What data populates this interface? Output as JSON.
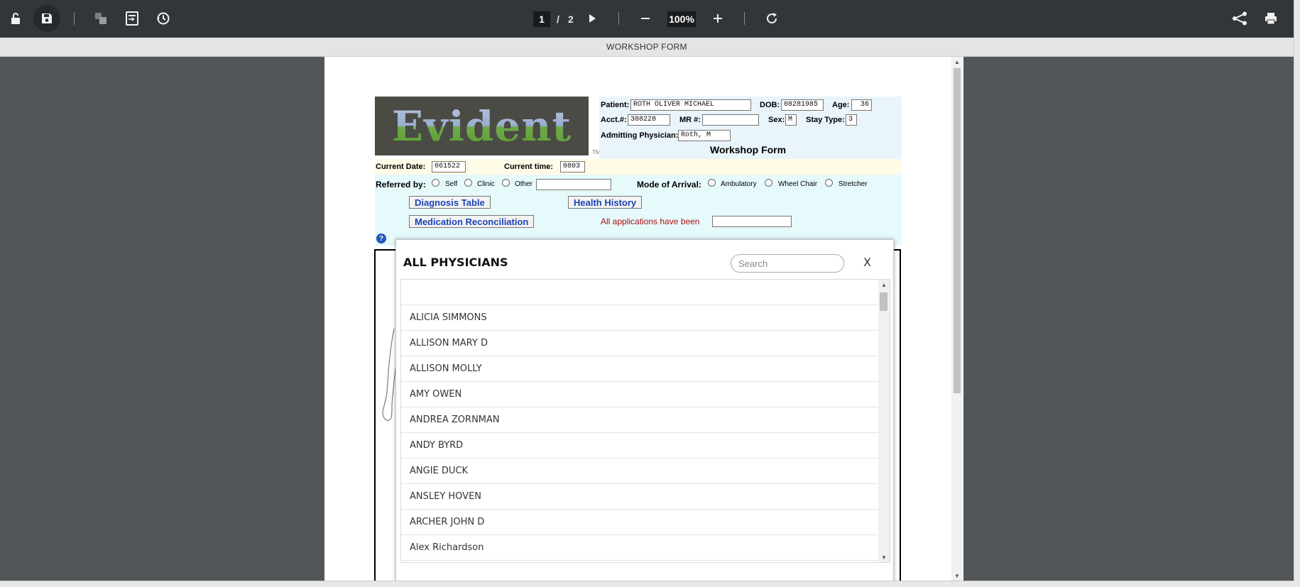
{
  "toolbar": {
    "current_page": "1",
    "page_separator": "/",
    "total_pages": "2",
    "zoom": "100%"
  },
  "document_title": "WORKSHOP FORM",
  "form": {
    "logo_text": "Evident",
    "logo_tm": "TM",
    "title": "Workshop Form",
    "patient_label": "Patient:",
    "patient_value": "ROTH OLIVER MICHAEL",
    "dob_label": "DOB:",
    "dob_value": "08281985",
    "age_label": "Age:",
    "age_value": "36",
    "acct_label": "Acct.#:",
    "acct_value": "388228",
    "mr_label": "MR #:",
    "mr_value": "",
    "sex_label": "Sex:",
    "sex_value": "M",
    "stay_label": "Stay Type:",
    "stay_value": "3",
    "admitting_label": "Admitting Physician:",
    "admitting_value": "Roth, M",
    "current_date_label": "Current Date:",
    "current_date_value": "061522",
    "current_time_label": "Current time:",
    "current_time_value": "0803",
    "referred_label": "Referred by:",
    "referred_options": [
      "Self",
      "Clinic",
      "Other"
    ],
    "arrival_label": "Mode of Arrival:",
    "arrival_options": [
      "Ambulatory",
      "Wheel Chair",
      "Stretcher"
    ],
    "diagnosis_button": "Diagnosis Table",
    "history_button": "Health History",
    "medication_button": "Medication Reconciliation",
    "applications_text": "All applications have been"
  },
  "modal": {
    "title": "ALL PHYSICIANS",
    "search_placeholder": "Search",
    "close_label": "X",
    "physicians": [
      "ALICIA SIMMONS",
      "ALLISON MARY D",
      "ALLISON MOLLY",
      "AMY OWEN",
      "ANDREA ZORNMAN",
      "ANDY BYRD",
      "ANGIE DUCK",
      "ANSLEY HOVEN",
      "ARCHER JOHN D",
      "Alex Richardson"
    ]
  }
}
